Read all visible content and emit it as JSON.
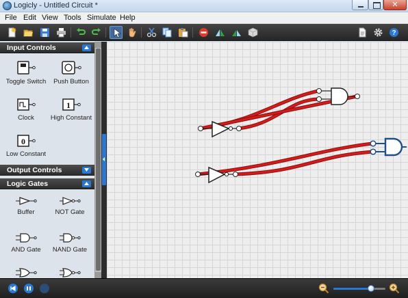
{
  "window": {
    "title": "Logicly - Untitled Circuit *"
  },
  "menu": [
    "File",
    "Edit",
    "View",
    "Tools",
    "Simulate",
    "Help"
  ],
  "toolbar": {
    "groups": [
      [
        "new-icon",
        "open-icon",
        "save-icon",
        "print-icon"
      ],
      [
        "undo-icon",
        "redo-icon"
      ],
      [
        "select-pointer-icon",
        "pan-hand-icon"
      ],
      [
        "cut-icon",
        "copy-icon",
        "paste-icon"
      ],
      [
        "delete-icon",
        "flip-horizontal-icon",
        "flip-vertical-icon",
        "integrated-circuit-icon"
      ]
    ],
    "right": [
      "document-properties-icon",
      "settings-gear-icon",
      "help-icon"
    ],
    "active_tool": "select-pointer-icon"
  },
  "sidebar": {
    "sections": [
      {
        "title": "Input Controls",
        "expanded": true,
        "items": [
          "Toggle Switch",
          "Push Button",
          "Clock",
          "High Constant",
          "Low Constant"
        ]
      },
      {
        "title": "Output Controls",
        "expanded": false,
        "items": []
      },
      {
        "title": "Logic Gates",
        "expanded": true,
        "items": [
          "Buffer",
          "NOT Gate",
          "AND Gate",
          "NAND Gate",
          "OR Gate",
          "NOR Gate"
        ]
      }
    ],
    "high_constant_glyph": "1",
    "low_constant_glyph": "0"
  },
  "canvas": {
    "components": [
      "NOT Gate",
      "NOT Gate",
      "AND Gate",
      "AND Gate"
    ],
    "wire_color_active": "#cc1b1b",
    "grid": true
  },
  "status": {
    "left_buttons": [
      "step-back-icon",
      "pause-icon",
      "simulation-status-icon"
    ],
    "zoom_level": 0.72,
    "zoom_icons": [
      "zoom-out-icon",
      "zoom-in-icon"
    ]
  },
  "colors": {
    "accent": "#2b78d4",
    "toolbar_bg": "#2f2f2f",
    "canvas_bg": "#eeeeee",
    "wire_on": "#cc1b1b"
  }
}
